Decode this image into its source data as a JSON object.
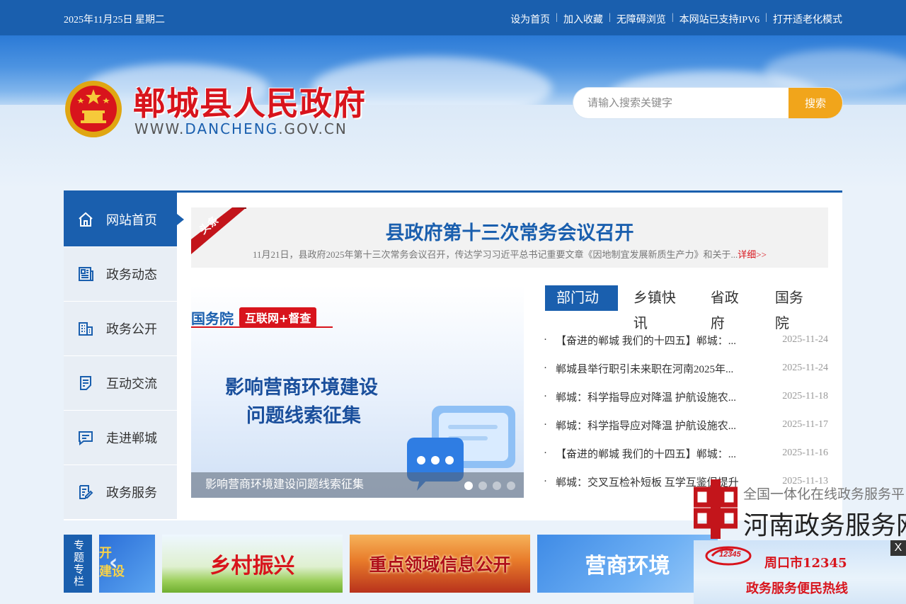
{
  "topbar": {
    "date": "2025年11月25日 星期二",
    "links": [
      "设为首页",
      "加入收藏",
      "无障碍浏览",
      "本网站已支持IPV6",
      "打开适老化模式"
    ]
  },
  "header": {
    "site_title": "郸城县人民政府",
    "site_url_prefix": "WWW.",
    "site_url_domain": "DANCHENG",
    "site_url_suffix": ".GOV.CN",
    "search_placeholder": "请输入搜索关键字",
    "search_button": "搜索"
  },
  "sidenav": {
    "items": [
      {
        "label": "网站首页",
        "icon": "home-icon"
      },
      {
        "label": "政务动态",
        "icon": "news-icon"
      },
      {
        "label": "政务公开",
        "icon": "building-icon"
      },
      {
        "label": "互动交流",
        "icon": "document-icon"
      },
      {
        "label": "走进郸城",
        "icon": "message-icon"
      },
      {
        "label": "政务服务",
        "icon": "service-icon"
      }
    ]
  },
  "headline": {
    "tag": "头条",
    "title": "县政府第十三次常务会议召开",
    "summary": "11月21日，县政府2025年第十三次常务会议召开，传达学习习近平总书记重要文章《因地制宜发展新质生产力》和关于...",
    "more": "详细>>"
  },
  "slider": {
    "badge_left": "国务院",
    "badge_right": "互联网+督查",
    "headline_line1": "影响营商环境建设",
    "headline_line2": "问题线索征集",
    "caption": "影响营商环境建设问题线索征集",
    "total": 4,
    "active": 1
  },
  "tabs": [
    "部门动态",
    "乡镇快讯",
    "省政府",
    "国务院"
  ],
  "news": [
    {
      "title": "【奋进的郸城 我们的十四五】郸城：...",
      "date": "2025-11-24"
    },
    {
      "title": "郸城县举行职引未来职在河南2025年...",
      "date": "2025-11-24"
    },
    {
      "title": "郸城：科学指导应对降温 护航设施农...",
      "date": "2025-11-18"
    },
    {
      "title": "郸城：科学指导应对降温 护航设施农...",
      "date": "2025-11-17"
    },
    {
      "title": "【奋进的郸城 我们的十四五】郸城：...",
      "date": "2025-11-16"
    },
    {
      "title": "郸城：交叉互检补短板 互学互鉴促提升",
      "date": "2025-11-13"
    }
  ],
  "special": {
    "label": "专题专栏",
    "cards": [
      "开 建设",
      "乡村振兴",
      "重点领域信息公开",
      "营商环境"
    ]
  },
  "float_service": {
    "line1": "全国一体化在线政务服务平台",
    "line2": "河南政务服务网"
  },
  "float_hotline": {
    "close": "X",
    "logo_text": "12345",
    "line1": "周口市12345",
    "line2": "政务服务便民热线"
  }
}
